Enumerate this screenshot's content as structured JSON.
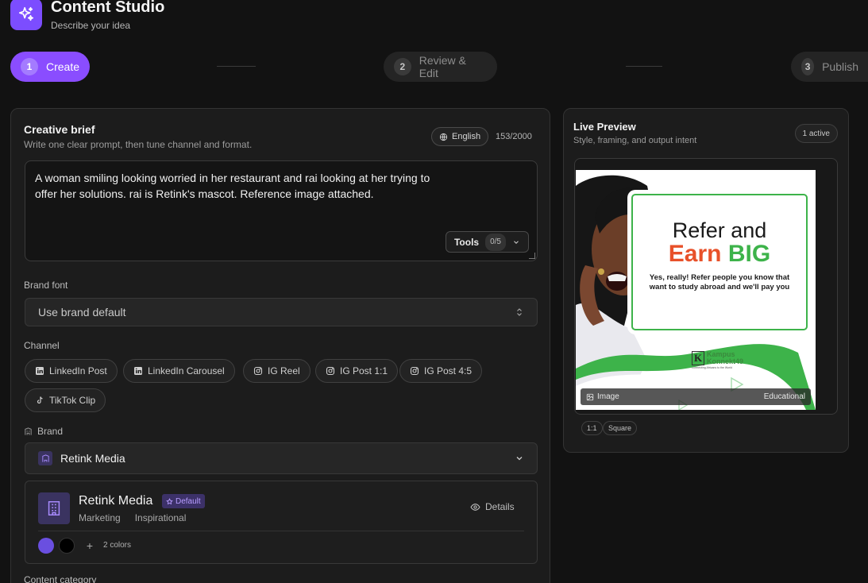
{
  "app": {
    "title": "Content Studio",
    "subtitle": "Describe your idea",
    "logo_icon": "sparkles-icon",
    "accent_color": "#8a4dff"
  },
  "stepper": {
    "steps": [
      {
        "number": "1",
        "label": "Create",
        "state": "active"
      },
      {
        "number": "2",
        "label": "Review & Edit",
        "state": "idle"
      },
      {
        "number": "3",
        "label": "Publish",
        "state": "idle"
      }
    ]
  },
  "brief": {
    "title": "Creative brief",
    "subtitle": "Write one clear prompt, then tune channel and format.",
    "language": "English",
    "char_count": "153/2000",
    "prompt": "A woman smiling looking worried in her restaurant and rai looking at her trying to offer her solutions. rai is Retink's mascot. Reference image attached.",
    "tools_label": "Tools",
    "tools_count": "0/5"
  },
  "brand_font": {
    "label": "Brand font",
    "value": "Use brand default"
  },
  "channel": {
    "label": "Channel",
    "options": [
      {
        "label": "LinkedIn Post",
        "icon": "linkedin-icon"
      },
      {
        "label": "LinkedIn Carousel",
        "icon": "linkedin-icon"
      },
      {
        "label": "IG Reel",
        "icon": "instagram-icon"
      },
      {
        "label": "IG Post 1:1",
        "icon": "instagram-icon"
      },
      {
        "label": "IG Post 4:5",
        "icon": "instagram-icon"
      },
      {
        "label": "TikTok Clip",
        "icon": "tiktok-icon"
      }
    ]
  },
  "brand": {
    "label": "Brand",
    "selected": "Retink Media",
    "card": {
      "name": "Retink Media",
      "badge": "Default",
      "tags": [
        "Marketing",
        "Inspirational"
      ],
      "details_label": "Details",
      "colors": [
        "#6a4fe0",
        "#000000"
      ],
      "colors_count": "2 colors"
    }
  },
  "content_category": {
    "label": "Content category"
  },
  "preview": {
    "title": "Live Preview",
    "subtitle": "Style, framing, and output intent",
    "active_badge": "1 active",
    "image_type": "Image",
    "category": "Educational",
    "ratio": "1:1",
    "shape": "Square",
    "creative": {
      "headline_1": "Refer and",
      "headline_2a": "Earn",
      "headline_2b": "BIG",
      "body": "Yes, really! Refer people you know that want to study abroad and we'll pay you",
      "logo_letter": "K",
      "logo_line1": "Kampus",
      "logo_line2": "Konnekt49",
      "logo_tagline": "Connecting Africans to the World"
    }
  }
}
